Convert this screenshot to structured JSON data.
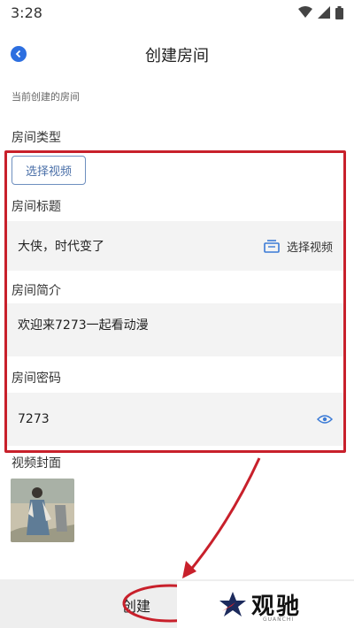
{
  "status_bar": {
    "time": "3:28"
  },
  "header": {
    "title": "创建房间"
  },
  "section_hint": "当前创建的房间",
  "room_type": {
    "label": "房间类型",
    "button_label": "选择视频"
  },
  "room_title": {
    "label": "房间标题",
    "value": "大侠，时代变了",
    "select_label": "选择视频"
  },
  "room_intro": {
    "label": "房间简介",
    "value": "欢迎来7273一起看动漫"
  },
  "room_password": {
    "label": "房间密码",
    "value": "7273"
  },
  "cover": {
    "label": "视频封面"
  },
  "bottom": {
    "create_label": "创建"
  },
  "watermark": {
    "text": "观驰",
    "sub": "GUANCHI"
  },
  "colors": {
    "accent": "#2d6fe0",
    "annotation": "#c8202b",
    "field_bg": "#f3f3f3"
  }
}
